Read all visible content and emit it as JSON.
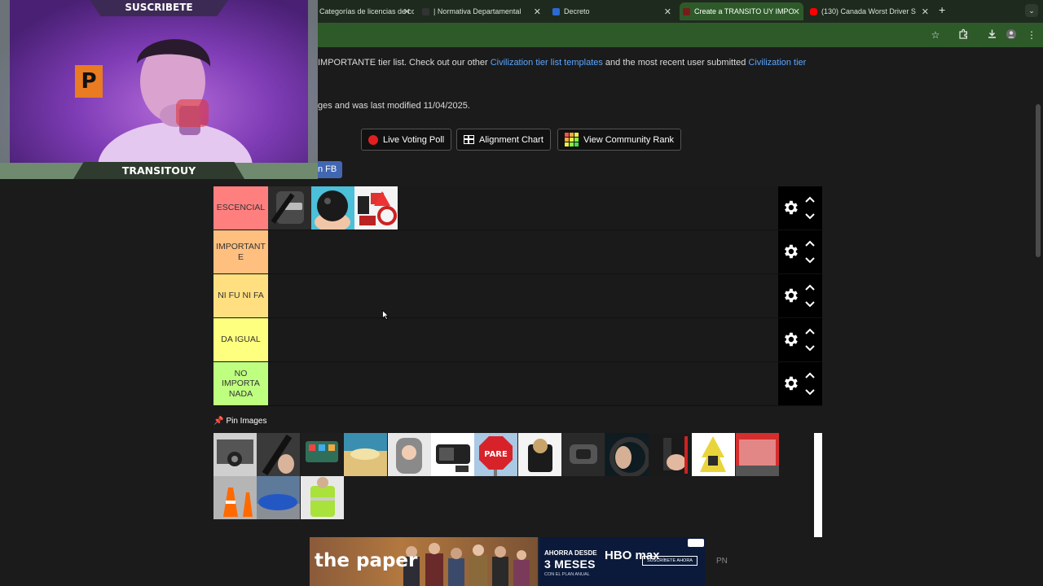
{
  "browser": {
    "tabs": [
      {
        "title": "Categorías de licencias de co",
        "favicon_color": "#2a5a9a",
        "active": false
      },
      {
        "title": "| Normativa Departamental",
        "favicon_color": "#333333",
        "active": false
      },
      {
        "title": "Decreto",
        "favicon_color": "#2b6bd1",
        "active": false
      },
      {
        "title": "Create a TRANSITO UY IMPO",
        "favicon_color": "#7a1b1b",
        "active": true
      },
      {
        "title": "(130) Canada Worst Driver S",
        "favicon_color": "#ff0000",
        "active": false
      }
    ],
    "new_tab": "+",
    "tab_menu": "⌄",
    "toolbar_icons": [
      "star-icon",
      "extensions-icon",
      "download-icon",
      "profile-icon",
      "menu-icon"
    ]
  },
  "page": {
    "desc_prefix": "IMPORTANTE tier list. Check out our other ",
    "desc_link1": "Civilization tier list templates",
    "desc_mid": " and the most recent user submitted ",
    "desc_link2": "Civilization tier",
    "desc_line2": "ges and was last modified 11/04/2025.",
    "buttons": {
      "live_voting": "Live Voting Poll",
      "alignment": "Alignment Chart",
      "community_rank": "View Community Rank"
    },
    "share_fb": "n FB",
    "pin_images": "Pin Images"
  },
  "tiers": [
    {
      "label": "ESCENCIAL",
      "color": "#ff7f7f",
      "item_count": 3
    },
    {
      "label": "IMPORTANTE",
      "color": "#ffbf7f",
      "item_count": 0
    },
    {
      "label": "NI FU NI FA",
      "color": "#ffdf7f",
      "item_count": 0
    },
    {
      "label": "DA IGUAL",
      "color": "#ffff7f",
      "item_count": 0
    },
    {
      "label": "NO IMPORTA NADA",
      "color": "#bfff7f",
      "item_count": 0
    }
  ],
  "pool": {
    "image_count": 16
  },
  "ad": {
    "headline": "the paper",
    "promo_line1": "AHORRA DESDE",
    "promo_line2": "3 MESES",
    "promo_line3": "CON EL PLAN ANUAL",
    "brand": "HBO max",
    "cta": "SUSCRÍBETE AHORA",
    "side_text": "PN"
  },
  "stream": {
    "subscribe_text": "SUSCRIBETE",
    "streamer_name": "TRANSITOUY",
    "sign_letter": "P"
  }
}
